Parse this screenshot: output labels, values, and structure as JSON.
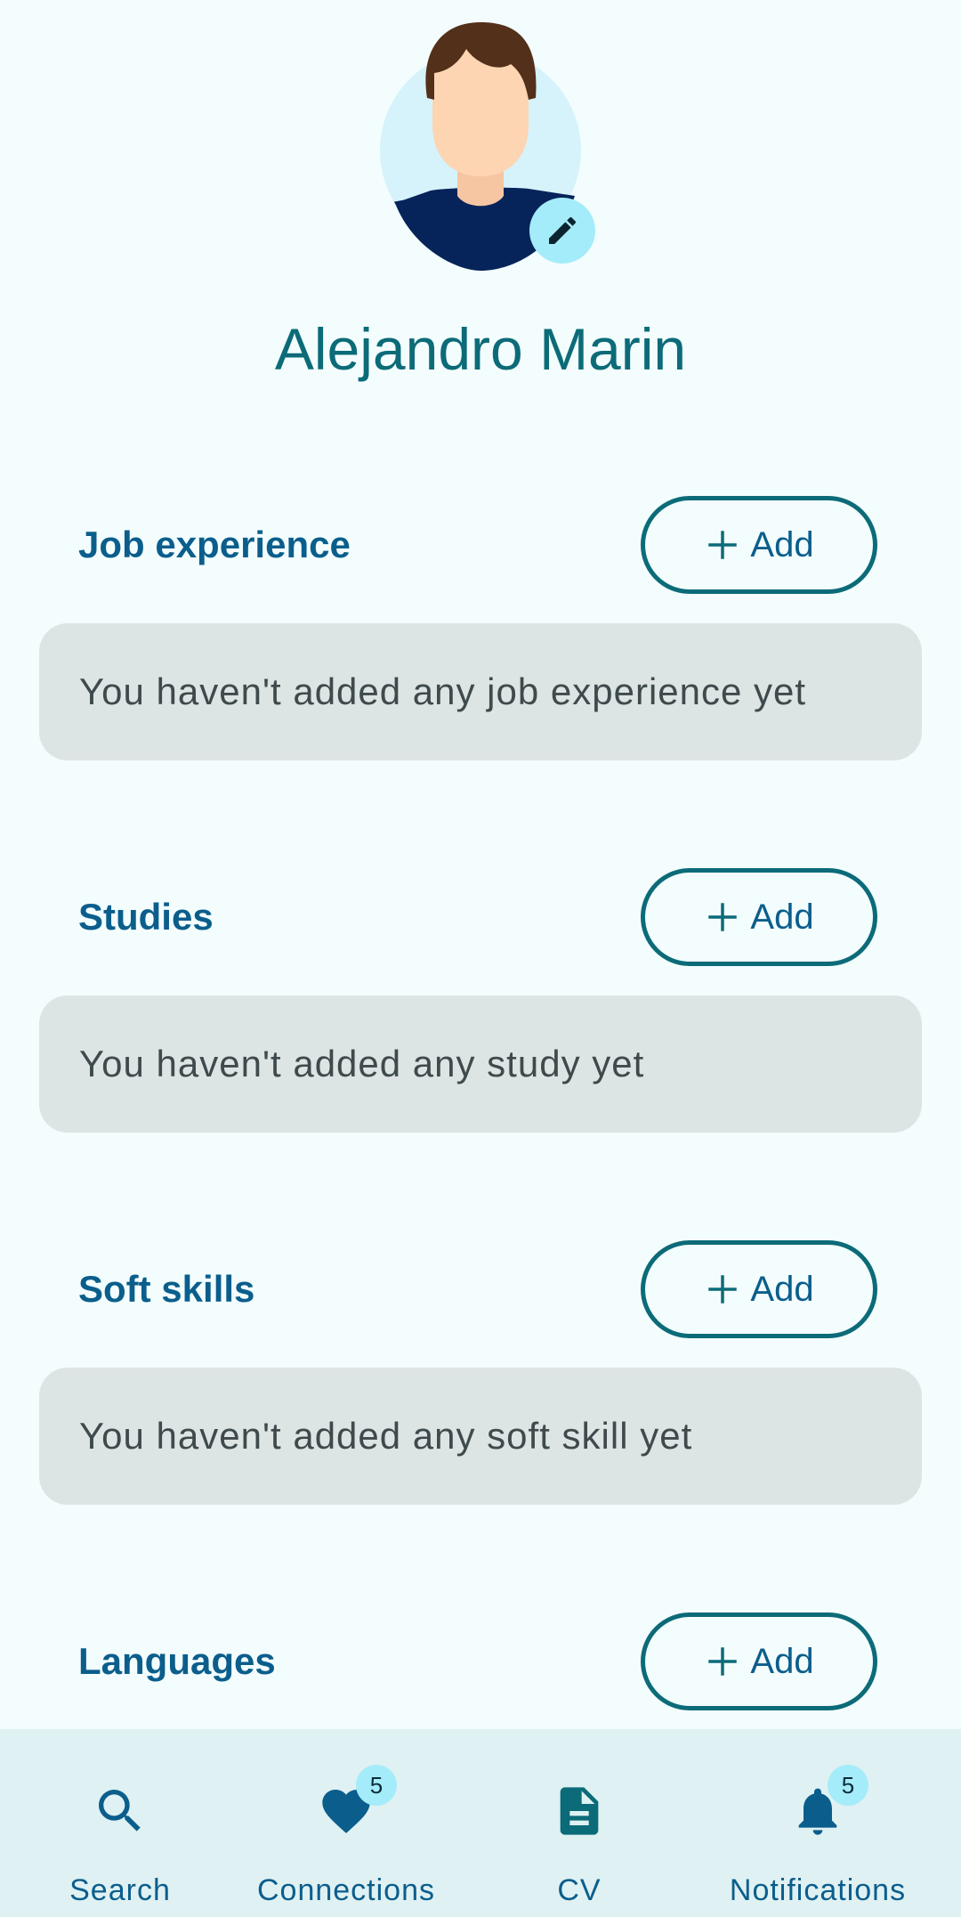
{
  "profile": {
    "name": "Alejandro Marin",
    "avatar_icon": "person-avatar-icon",
    "edit_icon": "pencil-icon"
  },
  "sections": [
    {
      "title": "Job experience",
      "add_label": "Add",
      "empty_text": "You haven't added any job experience yet"
    },
    {
      "title": "Studies",
      "add_label": "Add",
      "empty_text": "You haven't added any study yet"
    },
    {
      "title": "Soft skills",
      "add_label": "Add",
      "empty_text": "You haven't added any soft skill yet"
    },
    {
      "title": "Languages",
      "add_label": "Add"
    }
  ],
  "bottom_nav": {
    "items": [
      {
        "label": "Search",
        "icon": "search-icon"
      },
      {
        "label": "Connections",
        "icon": "heart-icon",
        "badge": "5"
      },
      {
        "label": "CV",
        "icon": "document-icon"
      },
      {
        "label": "Notifications",
        "icon": "bell-icon",
        "badge": "5"
      }
    ]
  },
  "colors": {
    "background": "#f3fdfd",
    "accent": "#0c6b78",
    "title_blue": "#0b5e8c",
    "card": "#dde4e4",
    "badge": "#a5ecfa",
    "nav_bar": "#dff1f3"
  }
}
